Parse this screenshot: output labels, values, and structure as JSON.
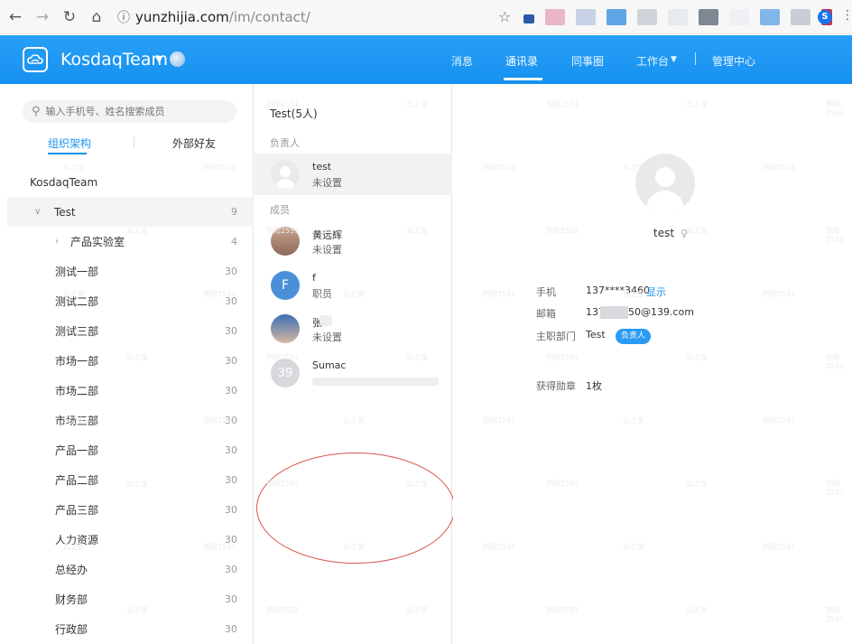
{
  "browser": {
    "url_host": "yunzhijia.com",
    "url_path": "/im/contact/",
    "profile_initial": "S"
  },
  "header": {
    "team_name": "KosdaqTeam",
    "nav": {
      "messages": "消息",
      "contacts": "通讯录",
      "colleagues": "同事圈",
      "workbench": "工作台",
      "admin": "管理中心"
    }
  },
  "left": {
    "search_placeholder": "输入手机号、姓名搜索成员",
    "tabs": {
      "org": "组织架构",
      "external": "外部好友"
    },
    "root": "KosdaqTeam",
    "selected": {
      "name": "Test",
      "count": "9"
    },
    "sub": {
      "name": "产品实验室",
      "count": "4"
    },
    "depts": [
      {
        "name": "测试一部",
        "count": "30"
      },
      {
        "name": "测试二部",
        "count": "30"
      },
      {
        "name": "测试三部",
        "count": "30"
      },
      {
        "name": "市场一部",
        "count": "30"
      },
      {
        "name": "市场二部",
        "count": "30"
      },
      {
        "name": "市场三部",
        "count": "30"
      },
      {
        "name": "产品一部",
        "count": "30"
      },
      {
        "name": "产品二部",
        "count": "30"
      },
      {
        "name": "产品三部",
        "count": "30"
      },
      {
        "name": "人力资源",
        "count": "30"
      },
      {
        "name": "总经办",
        "count": "30"
      },
      {
        "name": "财务部",
        "count": "30"
      },
      {
        "name": "行政部",
        "count": "30"
      }
    ]
  },
  "middle": {
    "title": "Test(5人)",
    "leader_label": "负责人",
    "member_label": "成员",
    "leader": {
      "name": "test",
      "role": "未设置"
    },
    "members": [
      {
        "name": "黄远辉",
        "role": "未设置"
      },
      {
        "name": "f",
        "role": "职员",
        "initial": "F"
      },
      {
        "name": "张",
        "role": "未设置"
      },
      {
        "name": "Sumac",
        "role": "",
        "initial": "39"
      }
    ]
  },
  "detail": {
    "name": "test",
    "phone_label": "手机",
    "phone": "137****3460",
    "show_label": "显示",
    "email_label": "邮箱",
    "email_prefix": "1379",
    "email_suffix": "50@139.com",
    "dept_label": "主职部门",
    "dept": "Test",
    "dept_badge": "负责人",
    "medal_label": "获得勋章",
    "medal": "1枚"
  },
  "colors": {
    "brand": "#1b9af7",
    "accent": "#1b95ee",
    "annotation": "#d9534f"
  }
}
